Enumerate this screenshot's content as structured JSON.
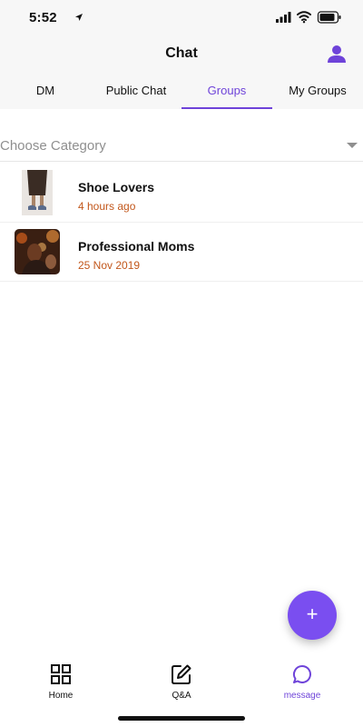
{
  "status_bar": {
    "time": "5:52"
  },
  "header": {
    "title": "Chat",
    "tabs": [
      {
        "label": "DM"
      },
      {
        "label": "Public Chat"
      },
      {
        "label": "Groups"
      },
      {
        "label": "My Groups"
      }
    ],
    "active_tab": "Groups"
  },
  "category": {
    "placeholder": "Choose Category"
  },
  "groups": [
    {
      "name": "Shoe Lovers",
      "time": "4 hours ago"
    },
    {
      "name": "Professional Moms",
      "time": "25 Nov 2019"
    }
  ],
  "fab": {
    "label": "+"
  },
  "bottom_nav": [
    {
      "label": "Home",
      "icon": "grid-icon"
    },
    {
      "label": "Q&A",
      "icon": "edit-icon"
    },
    {
      "label": "message",
      "icon": "chat-bubble-icon"
    }
  ],
  "colors": {
    "accent": "#6e43d9",
    "time_text": "#c2571b",
    "fab": "#7a4ef0"
  }
}
